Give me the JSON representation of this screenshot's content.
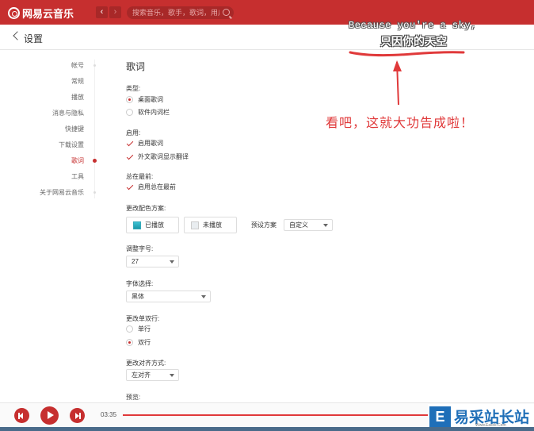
{
  "app": {
    "name": "网易云音乐",
    "colors": {
      "brand": "#c62f2f",
      "annotation": "#e0393a",
      "watermark": "#1f6fb8"
    }
  },
  "toolbar": {
    "back_icon": "chevron-left-icon",
    "back_label": "‹",
    "forward_label": "›",
    "search_placeholder": "搜索音乐，歌手，歌词，用户",
    "search_icon": "search-icon"
  },
  "header": {
    "title": "设置"
  },
  "sidebar": {
    "items": [
      {
        "label": "帐号",
        "active": false
      },
      {
        "label": "常规",
        "active": false
      },
      {
        "label": "播放",
        "active": false
      },
      {
        "label": "消息与隐私",
        "active": false
      },
      {
        "label": "快捷键",
        "active": false
      },
      {
        "label": "下载设置",
        "active": false
      },
      {
        "label": "歌词",
        "active": true
      },
      {
        "label": "工具",
        "active": false
      },
      {
        "label": "关于网易云音乐",
        "active": false
      }
    ]
  },
  "lyrics": {
    "title": "歌词",
    "type": {
      "label": "类型:",
      "options": [
        {
          "label": "桌面歌词",
          "selected": true
        },
        {
          "label": "软件内词栏",
          "selected": false
        }
      ]
    },
    "enable": {
      "label": "启用:",
      "options": [
        {
          "label": "启用歌词",
          "checked": true
        },
        {
          "label": "外文歌词显示翻译",
          "checked": true
        }
      ]
    },
    "on_top": {
      "label": "总在最前:",
      "options": [
        {
          "label": "启用总在最前",
          "checked": true
        }
      ]
    },
    "color_scheme": {
      "label": "更改配色方案:",
      "played_label": "已播放",
      "unplayed_label": "未播放",
      "preset_label": "预设方案",
      "preset_value": "自定义"
    },
    "font_size": {
      "label": "调整字号:",
      "value": "27"
    },
    "font": {
      "label": "字体选择:",
      "value": "黑体"
    },
    "line_mode": {
      "label": "更改单双行:",
      "options": [
        {
          "label": "单行",
          "selected": false
        },
        {
          "label": "双行",
          "selected": true
        }
      ]
    },
    "align": {
      "label": "更改对齐方式:",
      "value": "左对齐"
    },
    "preview": {
      "label": "预览:"
    }
  },
  "annotation": {
    "english": "Because you're a sky,",
    "chinese": "只因你的天空",
    "note": "看吧，这就大功告成啦！"
  },
  "player": {
    "time": "03:35",
    "progress": 0.74
  },
  "watermark": {
    "text": "易采站长站",
    "logo_letter": "E",
    "url": "Www.Easck.Com"
  }
}
